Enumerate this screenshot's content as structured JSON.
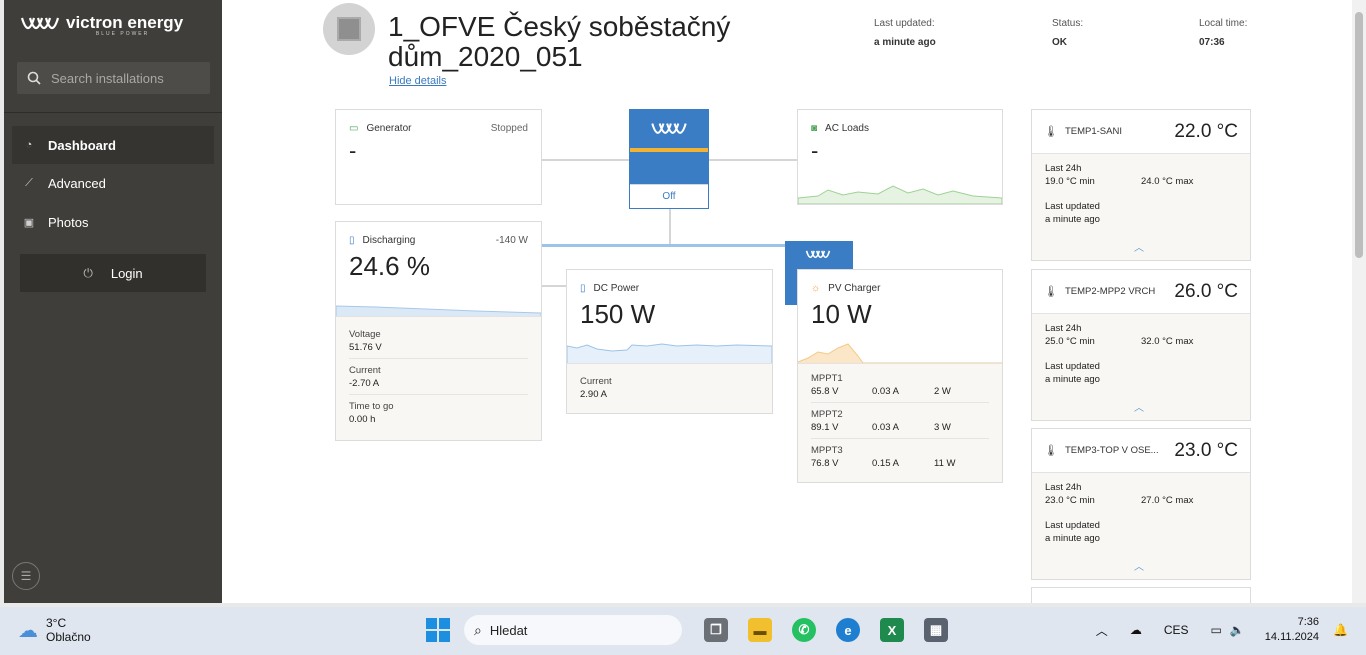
{
  "sidebar": {
    "brand": "victron energy",
    "brand_sub": "BLUE POWER",
    "search_placeholder": "Search installations",
    "nav": [
      {
        "label": "Dashboard",
        "icon": "dashboard-icon"
      },
      {
        "label": "Advanced",
        "icon": "advanced-icon"
      },
      {
        "label": "Photos",
        "icon": "photos-icon"
      }
    ],
    "login_label": "Login"
  },
  "header": {
    "title": "1_OFVE Český soběstačný dům_2020_051",
    "hide_details": "Hide details",
    "last_updated_label": "Last updated:",
    "last_updated_value": "a minute ago",
    "status_label": "Status:",
    "status_value": "OK",
    "local_time_label": "Local time:",
    "local_time_value": "07:36"
  },
  "generator": {
    "title": "Generator",
    "status": "Stopped",
    "value": "-"
  },
  "ac_loads": {
    "title": "AC Loads",
    "value": "-"
  },
  "inverter": {
    "state": "Off"
  },
  "battery": {
    "title": "Discharging",
    "power": "-140 W",
    "soc": "24.6 %",
    "details": [
      {
        "label": "Voltage",
        "value": "51.76 V"
      },
      {
        "label": "Current",
        "value": "-2.70 A"
      },
      {
        "label": "Time to go",
        "value": "0.00 h"
      }
    ]
  },
  "dc_power": {
    "title": "DC Power",
    "value": "150 W",
    "current_label": "Current",
    "current_value": "2.90 A"
  },
  "pv_charger": {
    "title": "PV Charger",
    "value": "10 W",
    "mppts": [
      {
        "name": "MPPT1",
        "voltage": "65.8 V",
        "current": "0.03 A",
        "power": "2 W"
      },
      {
        "name": "MPPT2",
        "voltage": "89.1 V",
        "current": "0.03 A",
        "power": "3 W"
      },
      {
        "name": "MPPT3",
        "voltage": "76.8 V",
        "current": "0.15 A",
        "power": "11 W"
      }
    ]
  },
  "temps": [
    {
      "name": "TEMP1-SANI",
      "value": "22.0 °C",
      "last24": "Last 24h",
      "min": "19.0 °C min",
      "max": "24.0 °C max",
      "updated_label": "Last updated",
      "updated": "a minute ago"
    },
    {
      "name": "TEMP2-MPP2 VRCH",
      "value": "26.0 °C",
      "last24": "Last 24h",
      "min": "25.0 °C min",
      "max": "32.0 °C max",
      "updated_label": "Last updated",
      "updated": "a minute ago"
    },
    {
      "name": "TEMP3-TOP V OSE...",
      "value": "23.0 °C",
      "last24": "Last 24h",
      "min": "23.0 °C min",
      "max": "27.0 °C max",
      "updated_label": "Last updated",
      "updated": "a minute ago"
    }
  ],
  "taskbar": {
    "weather_temp": "3°C",
    "weather_desc": "Oblačno",
    "search": "Hledat",
    "lang": "CES",
    "time": "7:36",
    "date": "14.11.2024"
  }
}
